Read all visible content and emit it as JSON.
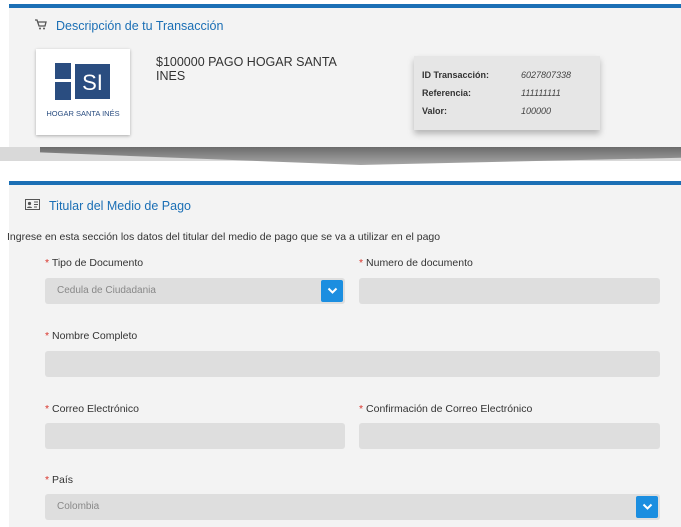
{
  "transaction": {
    "section_title": "Descripción de tu Transacción",
    "logo_mark": "SI",
    "logo_name": "HOGAR SANTA INÉS",
    "description": "$100000 PAGO HOGAR SANTA INES",
    "details": [
      {
        "label": "ID Transacción:",
        "value": "6027807338"
      },
      {
        "label": "Referencia:",
        "value": "111111111"
      },
      {
        "label": "Valor:",
        "value": "100000"
      }
    ]
  },
  "holder": {
    "section_title": "Titular del Medio de Pago",
    "intro": "Ingrese en esta sección los datos del titular del medio de pago que se va a utilizar en el pago",
    "required_mark": "*",
    "fields": {
      "doc_type": {
        "label": "Tipo de Documento",
        "value": "Cedula de Ciudadania"
      },
      "doc_number": {
        "label": "Numero de documento",
        "value": ""
      },
      "full_name": {
        "label": "Nombre Completo",
        "value": ""
      },
      "email": {
        "label": "Correo Electrónico",
        "value": ""
      },
      "email_confirm": {
        "label": "Confirmación de Correo Electrónico",
        "value": ""
      },
      "country": {
        "label": "País",
        "value": "Colombia"
      }
    }
  },
  "colors": {
    "accent": "#1b6fb5",
    "dropdown": "#1b8ee0",
    "required": "#d9342b",
    "logo": "#2a4d80"
  }
}
